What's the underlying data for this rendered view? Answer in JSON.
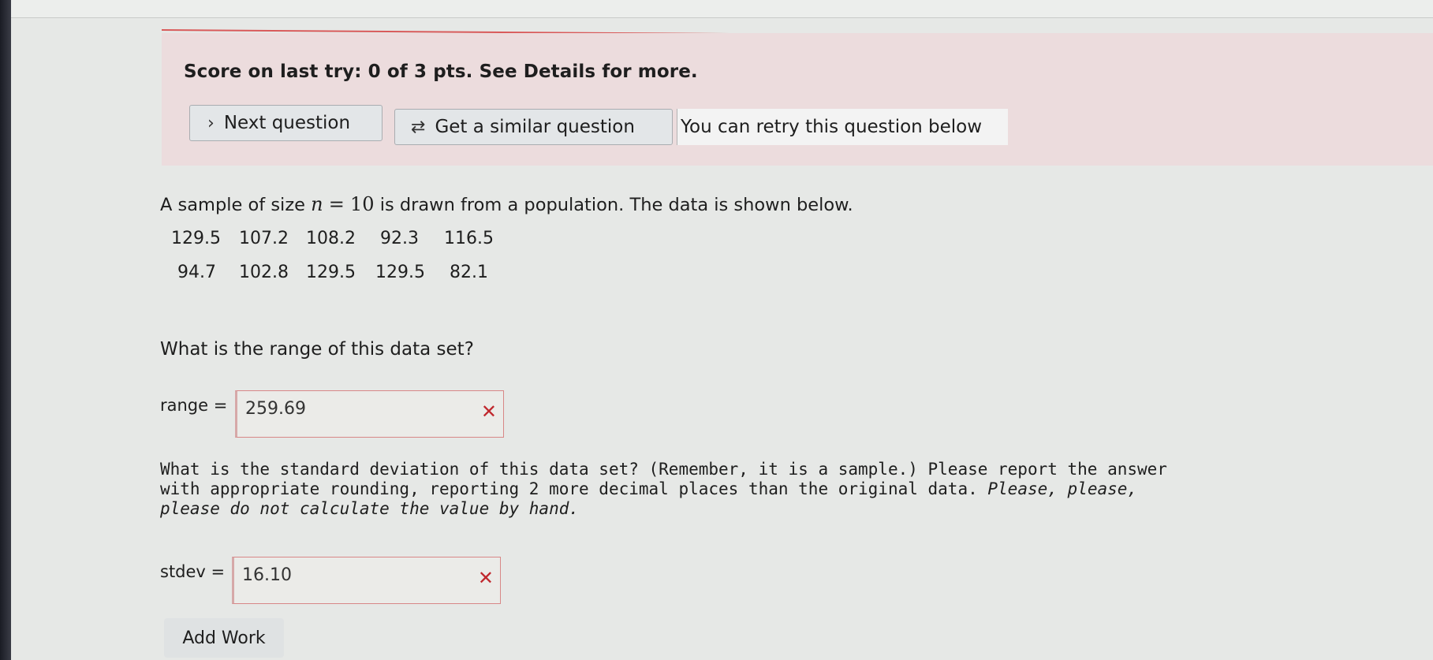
{
  "feedback": {
    "score_text": "Score on last try: 0 of 3 pts. See Details for more.",
    "next_label": "Next question",
    "similar_label": "Get a similar question",
    "retry_text": "You can retry this question below",
    "accent_color": "#d95a5a"
  },
  "question": {
    "intro_prefix": "A sample of size",
    "n_var": "n",
    "equals": "=",
    "n_value": "10",
    "intro_suffix": "is drawn from a population. The data is shown below.",
    "data_row_1": [
      "129.5",
      "107.2",
      "108.2",
      "92.3",
      "116.5"
    ],
    "data_row_2": [
      "94.7",
      "102.8",
      "129.5",
      "129.5",
      "82.1"
    ],
    "range_question": "What is the range of this data set?",
    "range_label": "range =",
    "range_value": "259.69",
    "stdev_question_main": "What is the standard deviation of this data set? (Remember, it is a sample.) Please report the answer with appropriate rounding, reporting 2 more decimal places than the original data.",
    "stdev_question_italic": "Please, please, please do not calculate the value by hand.",
    "stdev_label": "stdev =",
    "stdev_value": "16.10",
    "wrong_mark": "✕",
    "add_work_label": "Add Work"
  }
}
